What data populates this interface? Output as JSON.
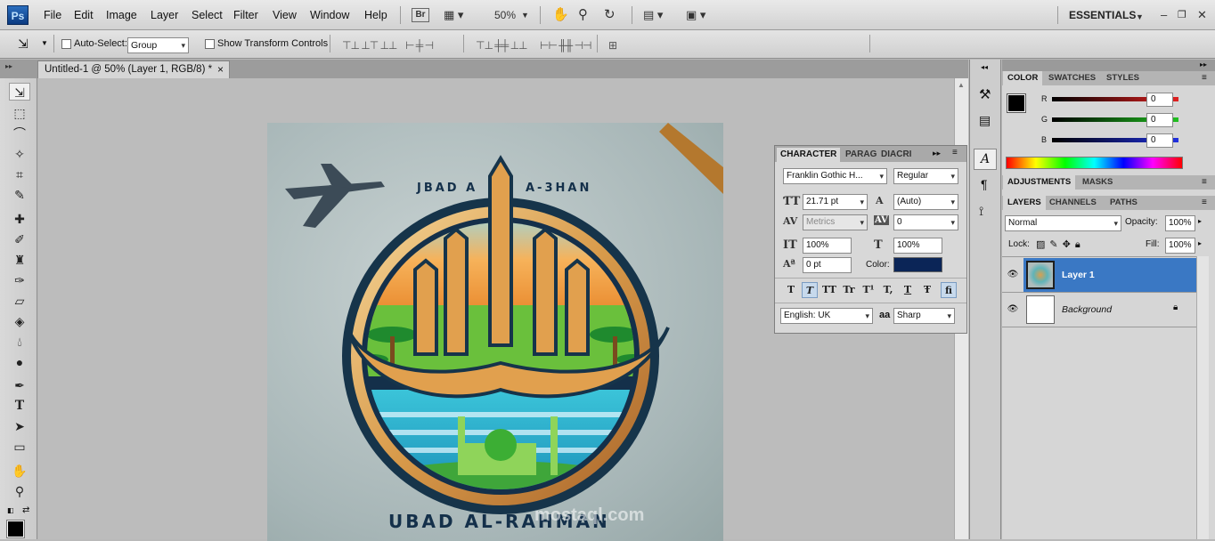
{
  "app": {
    "logo": "Ps",
    "workspace": "ESSENTIALS"
  },
  "menu": [
    "File",
    "Edit",
    "Image",
    "Layer",
    "Select",
    "Filter",
    "View",
    "Window",
    "Help"
  ],
  "appbar": {
    "bridge": "Br",
    "zoom": "50%"
  },
  "options": {
    "auto_select_label": "Auto-Select:",
    "auto_select_value": "Group",
    "show_transform_label": "Show Transform Controls"
  },
  "document": {
    "tab_title": "Untitled-1 @ 50% (Layer 1, RGB/8) *",
    "close": "×"
  },
  "artwork": {
    "top_text_left": "JBAD A",
    "top_text_right": "A-3HAN",
    "bottom_text": "UBAD AL-RAHMAN",
    "watermark": "mostaql.com"
  },
  "character_panel": {
    "tabs": [
      "CHARACTER",
      "PARAG",
      "DIACRI"
    ],
    "font_family": "Franklin Gothic H...",
    "font_style": "Regular",
    "font_size": "21.71 pt",
    "leading": "(Auto)",
    "kerning": "Metrics",
    "tracking": "0",
    "vertical_scale": "100%",
    "horizontal_scale": "100%",
    "baseline_shift": "0 pt",
    "color_label": "Color:",
    "color": "#0b2557",
    "type_buttons": [
      "T",
      "T",
      "TT",
      "Tr",
      "T¹",
      "T,",
      "T",
      "Ŧ",
      "fi"
    ],
    "language": "English: UK",
    "aa_label": "aa",
    "antialias": "Sharp"
  },
  "color_panel": {
    "tabs": [
      "COLOR",
      "SWATCHES",
      "STYLES"
    ],
    "channels": [
      {
        "label": "R",
        "value": "0",
        "color": "#e02020"
      },
      {
        "label": "G",
        "value": "0",
        "color": "#20c020"
      },
      {
        "label": "B",
        "value": "0",
        "color": "#2030e0"
      }
    ]
  },
  "adjustments_panel": {
    "tabs": [
      "ADJUSTMENTS",
      "MASKS"
    ]
  },
  "layers_panel": {
    "tabs": [
      "LAYERS",
      "CHANNELS",
      "PATHS"
    ],
    "blend_mode": "Normal",
    "opacity_label": "Opacity:",
    "opacity": "100%",
    "lock_label": "Lock:",
    "fill_label": "Fill:",
    "fill": "100%",
    "layers": [
      {
        "name": "Layer 1",
        "selected": true
      },
      {
        "name": "Background",
        "selected": false
      }
    ]
  }
}
